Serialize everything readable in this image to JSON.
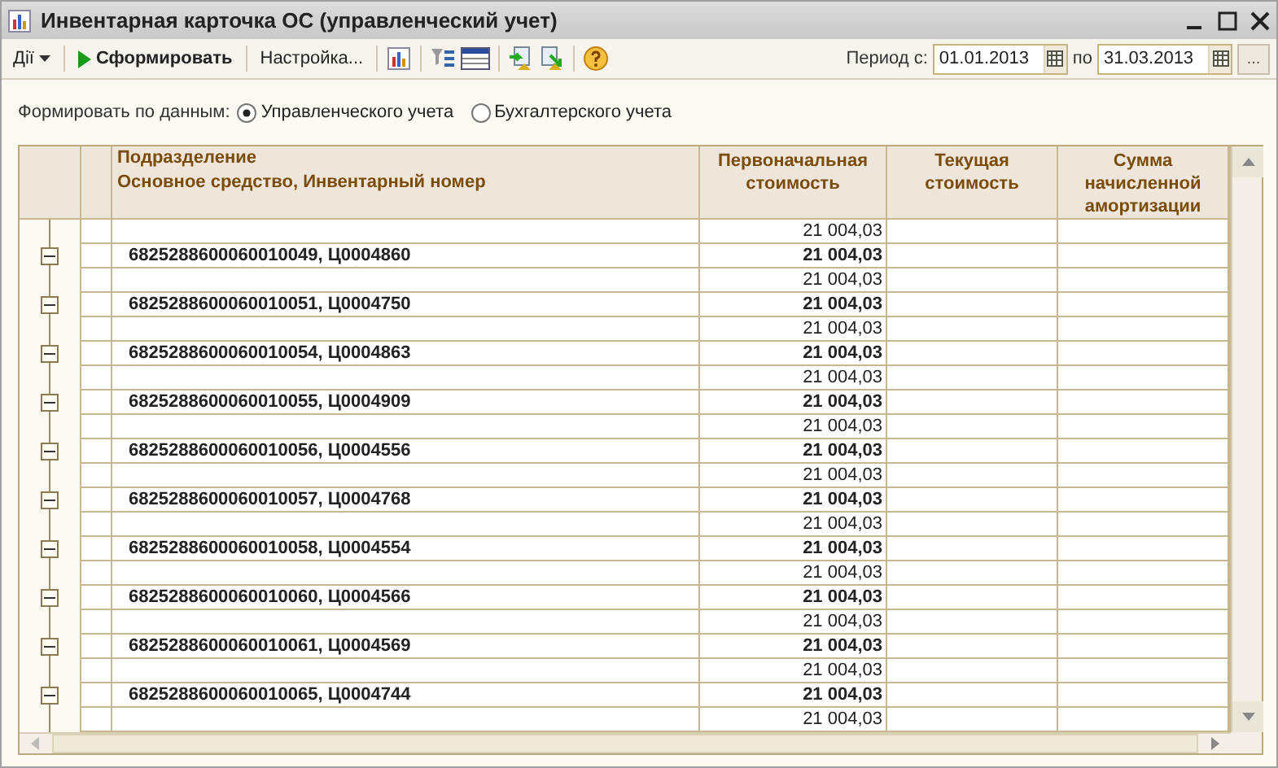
{
  "window": {
    "title": "Инвентарная карточка ОС (управленческий учет)"
  },
  "toolbar": {
    "actions_menu": "Дії",
    "run_button": "Сформировать",
    "settings_button": "Настройка...",
    "period_label": "Период с:",
    "date_from": "01.01.2013",
    "to_label": "по",
    "date_to": "31.03.2013",
    "more_button": "..."
  },
  "data_source": {
    "label": "Формировать по данным:",
    "options": [
      {
        "label": "Управленческого учета",
        "selected": true
      },
      {
        "label": "Бухгалтерского учета",
        "selected": false
      }
    ]
  },
  "table": {
    "header": {
      "group_column": "Подразделение",
      "item_column": "Основное средство, Инвентарный номер",
      "columns": [
        "Первоначальная стоимость",
        "Текущая стоимость",
        "Сумма начисленной амортизации"
      ]
    },
    "rows": [
      {
        "kind": "detail",
        "initial_cost": "21 004,03"
      },
      {
        "kind": "group",
        "name": "6825288600060010049, Ц0004860",
        "initial_cost": "21 004,03",
        "expanded": true
      },
      {
        "kind": "detail",
        "initial_cost": "21 004,03"
      },
      {
        "kind": "group",
        "name": "6825288600060010051, Ц0004750",
        "initial_cost": "21 004,03",
        "expanded": true
      },
      {
        "kind": "detail",
        "initial_cost": "21 004,03"
      },
      {
        "kind": "group",
        "name": "6825288600060010054, Ц0004863",
        "initial_cost": "21 004,03",
        "expanded": true
      },
      {
        "kind": "detail",
        "initial_cost": "21 004,03"
      },
      {
        "kind": "group",
        "name": "6825288600060010055, Ц0004909",
        "initial_cost": "21 004,03",
        "expanded": true
      },
      {
        "kind": "detail",
        "initial_cost": "21 004,03"
      },
      {
        "kind": "group",
        "name": "6825288600060010056, Ц0004556",
        "initial_cost": "21 004,03",
        "expanded": true
      },
      {
        "kind": "detail",
        "initial_cost": "21 004,03"
      },
      {
        "kind": "group",
        "name": "6825288600060010057, Ц0004768",
        "initial_cost": "21 004,03",
        "expanded": true
      },
      {
        "kind": "detail",
        "initial_cost": "21 004,03"
      },
      {
        "kind": "group",
        "name": "6825288600060010058, Ц0004554",
        "initial_cost": "21 004,03",
        "expanded": true
      },
      {
        "kind": "detail",
        "initial_cost": "21 004,03"
      },
      {
        "kind": "group",
        "name": "6825288600060010060, Ц0004566",
        "initial_cost": "21 004,03",
        "expanded": true
      },
      {
        "kind": "detail",
        "initial_cost": "21 004,03"
      },
      {
        "kind": "group",
        "name": "6825288600060010061, Ц0004569",
        "initial_cost": "21 004,03",
        "expanded": true
      },
      {
        "kind": "detail",
        "initial_cost": "21 004,03"
      },
      {
        "kind": "group",
        "name": "6825288600060010065, Ц0004744",
        "initial_cost": "21 004,03",
        "expanded": true
      },
      {
        "kind": "detail",
        "initial_cost": "21 004,03"
      }
    ]
  }
}
